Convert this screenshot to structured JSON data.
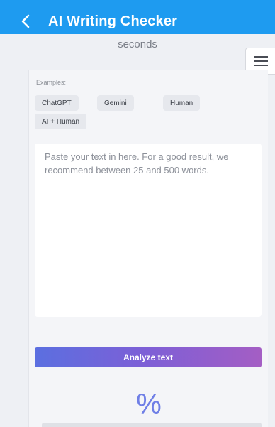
{
  "header": {
    "title": "AI Writing Checker"
  },
  "status": {
    "seconds_text": "seconds"
  },
  "examples": {
    "label": "Examples:",
    "chips": [
      "ChatGPT",
      "Gemini",
      "Human",
      "AI + Human"
    ]
  },
  "editor": {
    "placeholder": "Paste your text in here. For a good result, we recommend between 25 and 500 words."
  },
  "actions": {
    "analyze_label": "Analyze text"
  },
  "result": {
    "percent_symbol": "%"
  },
  "colors": {
    "topbar": "#1e9bf0",
    "accent": "#6f7fe6"
  }
}
